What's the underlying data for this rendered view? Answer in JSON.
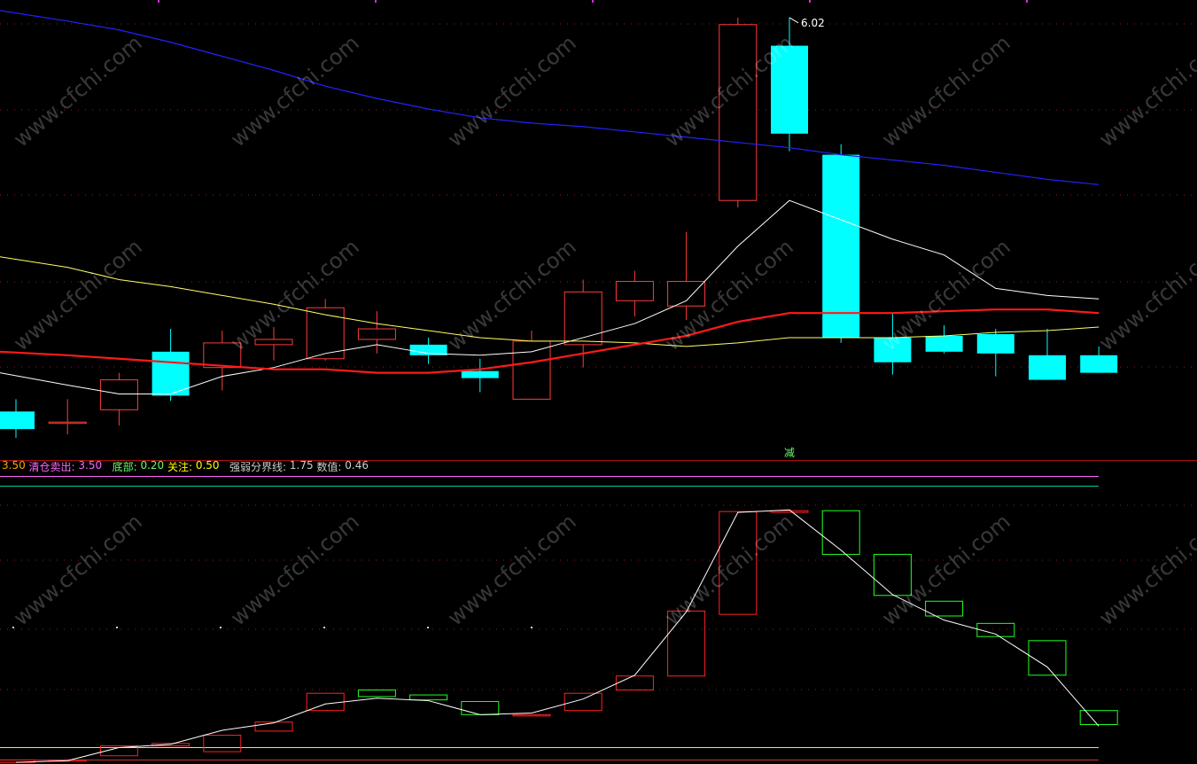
{
  "watermark": "www.cfchi.com",
  "price_label": "6.02",
  "signal_label": "减",
  "legend": [
    {
      "text": "3.50",
      "color": "#ffa500"
    },
    {
      "text": " 清仓卖出: ",
      "color": "#ff66ff"
    },
    {
      "text": "3.50",
      "color": "#ff66ff"
    },
    {
      "text": "   底部: ",
      "color": "#66ff66"
    },
    {
      "text": "0.20",
      "color": "#66ff66"
    },
    {
      "text": " 关注: ",
      "color": "#ffff00"
    },
    {
      "text": "0.50",
      "color": "#ffff00"
    },
    {
      "text": "   强弱分界线: ",
      "color": "#cccccc"
    },
    {
      "text": "1.75",
      "color": "#cccccc"
    },
    {
      "text": " 数值: ",
      "color": "#cccccc"
    },
    {
      "text": "0.46",
      "color": "#cccccc"
    }
  ],
  "colors": {
    "up": "#ff3b3b",
    "down": "#00ffff",
    "ma_white": "#ffffff",
    "ma_yellow": "#ffff66",
    "ma_red": "#ff1a1a",
    "ma_blue": "#2222ff",
    "lower_up": "#ff2222",
    "lower_down": "#22ff22",
    "lower_line": "#ffffff",
    "ref_magenta": "#ff66ff",
    "ref_cyan": "#00ccaa",
    "ref_yellow": "#ccff33"
  },
  "chart_data": [
    {
      "type": "candlestick",
      "ylim": [
        3.6,
        6.12
      ],
      "series": [
        {
          "name": "candles",
          "values": [
            [
              3.78,
              3.68,
              3.85,
              3.63
            ],
            [
              3.72,
              3.72,
              3.85,
              3.65
            ],
            [
              3.79,
              3.96,
              4.0,
              3.7
            ],
            [
              4.12,
              3.87,
              4.25,
              3.84
            ],
            [
              4.03,
              4.17,
              4.24,
              3.9
            ],
            [
              4.16,
              4.19,
              4.26,
              4.07
            ],
            [
              4.08,
              4.37,
              4.42,
              4.07
            ],
            [
              4.19,
              4.25,
              4.35,
              4.11
            ],
            [
              4.16,
              4.1,
              4.2,
              4.05
            ],
            [
              4.01,
              3.97,
              4.08,
              3.89
            ],
            [
              3.85,
              4.18,
              4.24,
              3.85
            ],
            [
              4.16,
              4.46,
              4.53,
              4.03
            ],
            [
              4.41,
              4.52,
              4.58,
              4.32
            ],
            [
              4.38,
              4.52,
              4.8,
              4.3
            ],
            [
              4.98,
              5.98,
              6.02,
              4.94
            ],
            [
              5.86,
              5.36,
              6.02,
              5.26
            ],
            [
              5.24,
              4.2,
              5.3,
              4.17
            ],
            [
              4.2,
              4.06,
              4.34,
              3.99
            ],
            [
              4.21,
              4.12,
              4.27,
              4.11
            ],
            [
              4.22,
              4.11,
              4.25,
              3.98
            ],
            [
              4.1,
              3.96,
              4.25,
              3.96
            ],
            [
              4.1,
              4.0,
              4.15,
              4.0
            ]
          ]
        },
        {
          "name": "",
          "values": [
            4.0,
            3.93,
            3.88,
            3.88,
            3.98,
            4.03,
            4.11,
            4.16,
            4.11,
            4.1,
            4.12,
            4.2,
            4.28,
            4.41,
            4.72,
            4.98,
            4.87,
            4.76,
            4.67,
            4.48,
            4.44,
            4.42
          ]
        },
        {
          "name": "",
          "values": [
            4.66,
            4.6,
            4.53,
            4.49,
            4.44,
            4.39,
            4.33,
            4.28,
            4.24,
            4.2,
            4.18,
            4.18,
            4.17,
            4.15,
            4.17,
            4.2,
            4.2,
            4.2,
            4.21,
            4.23,
            4.24,
            4.26
          ]
        },
        {
          "name": "",
          "values": [
            4.12,
            4.1,
            4.08,
            4.06,
            4.04,
            4.02,
            4.02,
            4.0,
            4.0,
            4.02,
            4.06,
            4.11,
            4.16,
            4.21,
            4.29,
            4.34,
            4.34,
            4.34,
            4.35,
            4.36,
            4.36,
            4.34
          ]
        },
        {
          "name": "",
          "values": [
            6.06,
            6.0,
            5.95,
            5.88,
            5.8,
            5.72,
            5.63,
            5.56,
            5.5,
            5.45,
            5.42,
            5.4,
            5.37,
            5.34,
            5.31,
            5.28,
            5.24,
            5.21,
            5.18,
            5.14,
            5.1,
            5.07
          ]
        }
      ]
    },
    {
      "type": "bar",
      "ylim": [
        0.0,
        3.6
      ],
      "references": [
        3.5,
        3.38,
        0.2
      ],
      "series": [
        {
          "name": "blocks",
          "values": [
            [
              0.02,
              0.05
            ],
            [
              0.05,
              0.05
            ],
            [
              0.1,
              0.22
            ],
            [
              0.22,
              0.25
            ],
            [
              0.15,
              0.35
            ],
            [
              0.4,
              0.51
            ],
            [
              0.65,
              0.86
            ],
            [
              0.9,
              0.82
            ],
            [
              0.84,
              0.78
            ],
            [
              0.76,
              0.6
            ],
            [
              0.6,
              0.6
            ],
            [
              0.65,
              0.86
            ],
            [
              0.9,
              1.07
            ],
            [
              1.07,
              1.86
            ],
            [
              1.82,
              3.07
            ],
            [
              3.06,
              3.08
            ],
            [
              3.08,
              2.55
            ],
            [
              2.55,
              2.05
            ],
            [
              1.98,
              1.8
            ],
            [
              1.71,
              1.55
            ],
            [
              1.5,
              1.08
            ],
            [
              0.65,
              0.48
            ]
          ]
        },
        {
          "name": "",
          "values": [
            0.02,
            0.04,
            0.2,
            0.24,
            0.41,
            0.5,
            0.73,
            0.8,
            0.77,
            0.6,
            0.62,
            0.79,
            1.08,
            1.85,
            3.06,
            3.09,
            2.6,
            2.06,
            1.75,
            1.58,
            1.18,
            0.46
          ]
        }
      ]
    }
  ]
}
